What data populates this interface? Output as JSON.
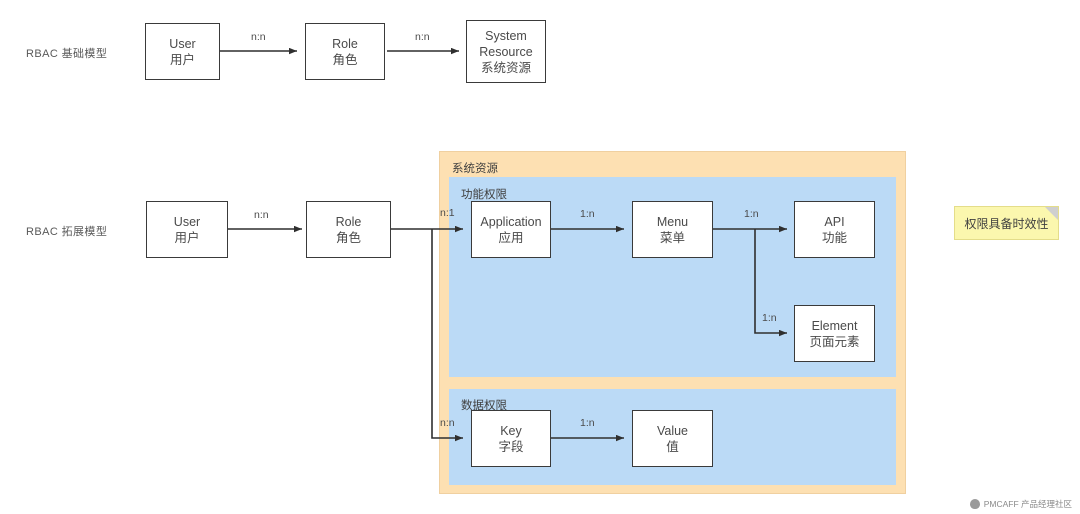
{
  "diagram": {
    "title_basic": "RBAC 基础模型",
    "title_extended": "RBAC 拓展模型",
    "regions": {
      "system_resource": "系统资源",
      "function_permission": "功能权限",
      "data_permission": "数据权限"
    },
    "colors": {
      "outer_region": "#fde0b2",
      "inner_region": "#bbdaf6",
      "node_border": "#3a3a3a",
      "node_fill": "#ffffff",
      "sticky_fill": "#fbf7ae",
      "text": "#4a4a4a"
    },
    "basic_model": {
      "nodes": [
        {
          "en": "User",
          "cn": "用户"
        },
        {
          "en": "Role",
          "cn": "角色"
        },
        {
          "en": "System Resource",
          "cn": "系统资源",
          "en_line1": "System",
          "en_line2": "Resource"
        }
      ],
      "edges": [
        {
          "from": "User",
          "to": "Role",
          "label": "n:n"
        },
        {
          "from": "Role",
          "to": "System Resource",
          "label": "n:n"
        }
      ]
    },
    "extended_model": {
      "nodes": [
        {
          "en": "User",
          "cn": "用户"
        },
        {
          "en": "Role",
          "cn": "角色"
        },
        {
          "en": "Application",
          "cn": "应用"
        },
        {
          "en": "Menu",
          "cn": "菜单"
        },
        {
          "en": "API",
          "cn": "功能"
        },
        {
          "en": "Element",
          "cn": "页面元素"
        },
        {
          "en": "Key",
          "cn": "字段"
        },
        {
          "en": "Value",
          "cn": "值"
        }
      ],
      "edges": [
        {
          "from": "User",
          "to": "Role",
          "label": "n:n"
        },
        {
          "from": "Role",
          "to": "Application",
          "label": "n:1"
        },
        {
          "from": "Application",
          "to": "Menu",
          "label": "1:n"
        },
        {
          "from": "Menu",
          "to": "API",
          "label": "1:n"
        },
        {
          "from": "Menu",
          "to": "Element",
          "label": "1:n"
        },
        {
          "from": "Role",
          "to": "Key",
          "label": "n:n"
        },
        {
          "from": "Key",
          "to": "Value",
          "label": "1:n"
        }
      ]
    },
    "note": {
      "text": "权限具备时效性"
    },
    "watermark": {
      "text": "PMCAFF 产品经理社区",
      "logo": "pmcaff-logo-icon"
    }
  }
}
